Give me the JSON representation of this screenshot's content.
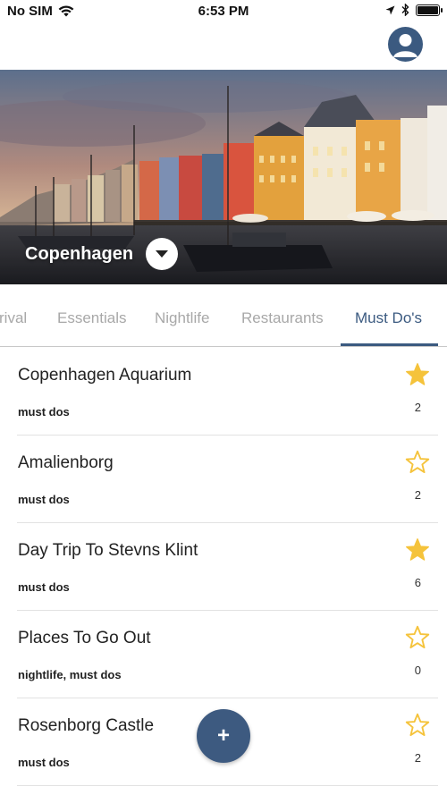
{
  "status_bar": {
    "carrier": "No SIM",
    "time": "6:53 PM"
  },
  "header": {
    "city": "Copenhagen"
  },
  "tabs": [
    {
      "label": "rival",
      "name": "tab-arrival"
    },
    {
      "label": "Essentials",
      "name": "tab-essentials"
    },
    {
      "label": "Nightlife",
      "name": "tab-nightlife"
    },
    {
      "label": "Restaurants",
      "name": "tab-restaurants"
    },
    {
      "label": "Must Do's",
      "name": "tab-must-dos",
      "active": true
    }
  ],
  "items": [
    {
      "title": "Copenhagen Aquarium",
      "tags": "must dos",
      "count": "2",
      "starred": true
    },
    {
      "title": "Amalienborg",
      "tags": "must dos",
      "count": "2",
      "starred": false
    },
    {
      "title": "Day Trip To Stevns Klint",
      "tags": "must dos",
      "count": "6",
      "starred": true
    },
    {
      "title": "Places To Go Out",
      "tags": "nightlife, must dos",
      "count": "0",
      "starred": false
    },
    {
      "title": "Rosenborg Castle",
      "tags": "must dos",
      "count": "2",
      "starred": false
    }
  ],
  "fab": {
    "label": "+"
  },
  "colors": {
    "accent": "#3b5a80",
    "star": "#f5c33b",
    "inactive_tab": "#a8a8a8"
  },
  "icons": {
    "wifi": "wifi-icon",
    "location": "location-arrow-icon",
    "bluetooth": "bluetooth-icon",
    "battery": "battery-icon",
    "avatar": "user-icon",
    "dropdown": "caret-down-icon",
    "star": "star-icon"
  }
}
